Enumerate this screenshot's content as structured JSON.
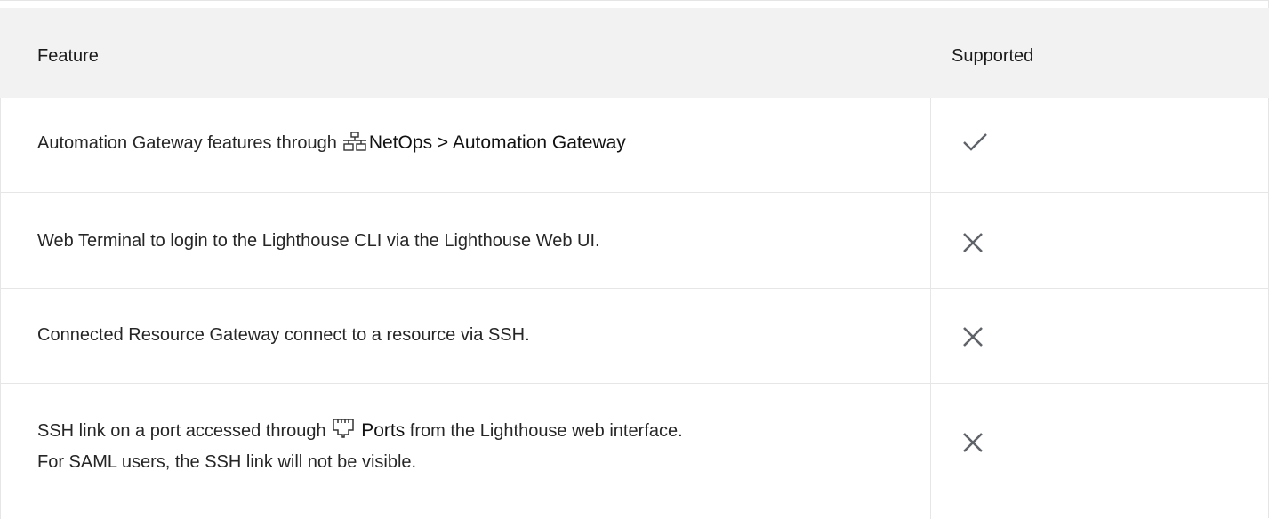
{
  "table": {
    "headers": {
      "feature": "Feature",
      "supported": "Supported"
    },
    "rows": [
      {
        "text_before": "Automation Gateway features through",
        "icon": "network-icon",
        "menu_ref": "NetOps > Automation Gateway",
        "text_after": "",
        "supported": "check"
      },
      {
        "text": "Web Terminal to login to the Lighthouse CLI via the Lighthouse Web UI.",
        "supported": "cross"
      },
      {
        "text": "Connected Resource Gateway connect to a resource via SSH.",
        "supported": "cross"
      },
      {
        "text_before": "SSH link on a port accessed through",
        "icon": "ethernet-port-icon",
        "menu_ref": "Ports",
        "text_after": "from the Lighthouse web interface.",
        "line2": "For SAML users, the SSH link will not be visible.",
        "supported": "cross"
      }
    ]
  },
  "colors": {
    "icon": "#5f6368",
    "header_bg": "#f2f2f2",
    "border": "#e6e6e6"
  }
}
